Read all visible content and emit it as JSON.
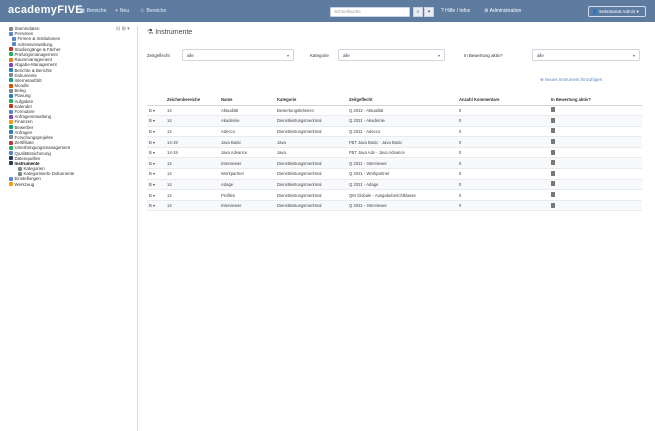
{
  "app": {
    "brand": "academyFIVE",
    "nav": [
      {
        "icon": "apps-icon",
        "label": "Bereiche"
      },
      {
        "icon": "plus-icon",
        "label": "Neu"
      },
      {
        "icon": "star-icon",
        "label": "Bereiche"
      }
    ],
    "search": {
      "placeholder": "Schnellsuche"
    },
    "right_nav": [
      {
        "icon": "help-icon",
        "label": "Hilfe / Infos"
      },
      {
        "icon": "settings-icon",
        "label": "Administration"
      }
    ],
    "user": {
      "label": "Sekretariat Admin"
    }
  },
  "sidebar": {
    "tools": "⊟ ⊞ ▾",
    "items": [
      {
        "label": "Stammdaten",
        "color": "#7f8c8d"
      },
      {
        "label": "Personen",
        "color": "#5b86c5"
      },
      {
        "label": "Firmen & Institutionen",
        "color": "#5b86c5"
      },
      {
        "label": "Adressverwaltung",
        "color": "#5b86c5"
      },
      {
        "label": "Studiengänge & Fächer",
        "color": "#c0392b"
      },
      {
        "label": "Prüfungsmanagement",
        "color": "#27ae60"
      },
      {
        "label": "Raummanagement",
        "color": "#e67e22"
      },
      {
        "label": "Abgabe-Management",
        "color": "#8e44ad"
      },
      {
        "label": "Berichte & Berichte",
        "color": "#2980b9"
      },
      {
        "label": "Dokumente",
        "color": "#7f8c8d"
      },
      {
        "label": "Internetauftritt",
        "color": "#16a085"
      },
      {
        "label": "Moodle",
        "color": "#d35400"
      },
      {
        "label": "Beleg",
        "color": "#7f8c8d"
      },
      {
        "label": "Planung",
        "color": "#2980b9"
      },
      {
        "label": "Aufgaben",
        "color": "#27ae60"
      },
      {
        "label": "Kalender",
        "color": "#c0392b"
      },
      {
        "label": "Formulare",
        "color": "#5b86c5"
      },
      {
        "label": "Anfrageverwaltung",
        "color": "#8e44ad"
      },
      {
        "label": "Finanzen",
        "color": "#f39c12"
      },
      {
        "label": "Bewerber",
        "color": "#16a085"
      },
      {
        "label": "Anfragen",
        "color": "#2980b9"
      },
      {
        "label": "Forschungsprojekte",
        "color": "#7f8c8d"
      },
      {
        "label": "Zertifikate",
        "color": "#c0392b"
      },
      {
        "label": "Unterbringungsmanagement",
        "color": "#27ae60"
      },
      {
        "label": "Qualitätssicherung",
        "color": "#5b86c5"
      },
      {
        "label": "Datenquellen",
        "color": "#2c3e50"
      },
      {
        "label": "Instrumente",
        "color": "#2c3e50",
        "active": true
      },
      {
        "label": "Kategorien",
        "color": "#7f8c8d"
      },
      {
        "label": "Kategorisierte Dokumente",
        "color": "#7f8c8d"
      },
      {
        "label": "Einstellungen",
        "color": "#5b86c5"
      },
      {
        "label": "Werkzeug",
        "color": "#f39c12"
      }
    ]
  },
  "main": {
    "title": "Instrumente",
    "filters": [
      {
        "label": "Zeitgeflecht",
        "value": "alle"
      },
      {
        "label": "Kategorie",
        "value": "alle"
      },
      {
        "label": "In Bewertung aktiv?",
        "value": "alle"
      }
    ],
    "add_link": "Neues Instrument hinzufügen",
    "table": {
      "columns": [
        "",
        "Zeichenbereiche",
        "Name",
        "Kategorie",
        "Zeitgeflecht",
        "Anzahl Kommentare",
        "In Bewertung aktiv?"
      ],
      "rows": [
        [
          "B ▾",
          "14",
          "Aktualität",
          "Bewertungskriterien",
          "Q 2022 - Aktualität",
          "0",
          "trash"
        ],
        [
          "B ▾",
          "14",
          "Akademie",
          "Dienstleistungsmerkmal",
          "Q 2021 - Akademie",
          "0",
          "trash"
        ],
        [
          "B ▾",
          "14",
          "Adecco",
          "Dienstleistungsmerkmal",
          "Q 2021 - Adecco",
          "0",
          "trash"
        ],
        [
          "B ▾",
          "14-19",
          "Java Basic",
          "Java",
          "FBT Java Basic - Java Basic",
          "0",
          "trash"
        ],
        [
          "B ▾",
          "14-19",
          "Java Advance",
          "Java",
          "FBT Java Adv - Java Advance",
          "0",
          "trash"
        ],
        [
          "B ▾",
          "14",
          "Interviewer",
          "Dienstleistungsmerkmal",
          "Q 2021 - Interviewer",
          "0",
          "trash"
        ],
        [
          "B ▾",
          "14",
          "Workpartner",
          "Dienstleistungsmerkmal",
          "Q 2021 - Workpartner",
          "0",
          "trash"
        ],
        [
          "B ▾",
          "14",
          "Adage",
          "Dienstleistungsmerkmal",
          "Q 2021 - Adage",
          "0",
          "trash"
        ],
        [
          "B ▾",
          "14",
          "Profiles",
          "Dienstleistungsmerkmal",
          "QM Globale - Ausgabeberichtklasse",
          "0",
          "trash"
        ],
        [
          "B ▾",
          "14",
          "Interviewer",
          "Dienstleistungsmerkmal",
          "Q 2021 - Interviewer",
          "0",
          "trash"
        ]
      ]
    }
  }
}
